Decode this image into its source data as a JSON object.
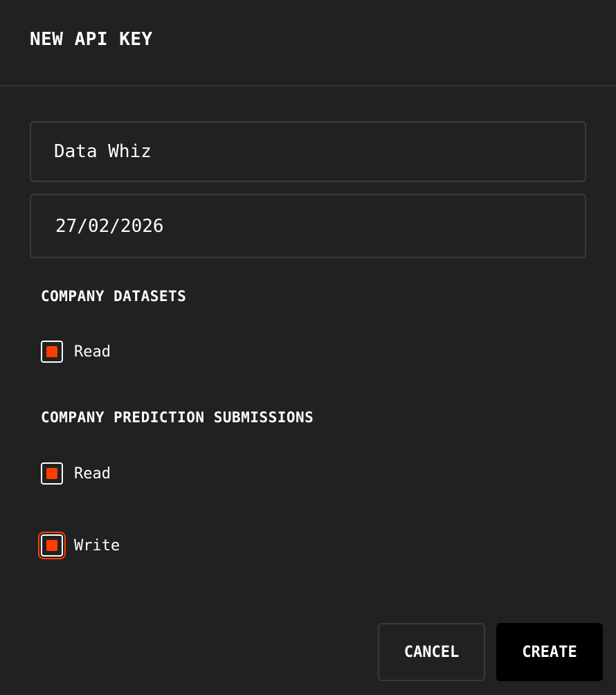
{
  "dialog": {
    "title": "NEW API KEY",
    "name_field": {
      "value": "Data Whiz",
      "placeholder": ""
    },
    "expiry_field": {
      "value": "27/02/2026",
      "placeholder": ""
    },
    "sections": [
      {
        "label": "COMPANY DATASETS",
        "options": [
          {
            "label": "Read",
            "checked": true
          }
        ]
      },
      {
        "label": "COMPANY PREDICTION SUBMISSIONS",
        "options": [
          {
            "label": "Read",
            "checked": true
          },
          {
            "label": "Write",
            "checked": true
          }
        ]
      }
    ],
    "cancel_label": "CANCEL",
    "create_label": "CREATE"
  },
  "colors": {
    "background": "#212121",
    "accent": "#ff3d00",
    "border": "#3a3a3a",
    "primary_button": "#000000"
  }
}
